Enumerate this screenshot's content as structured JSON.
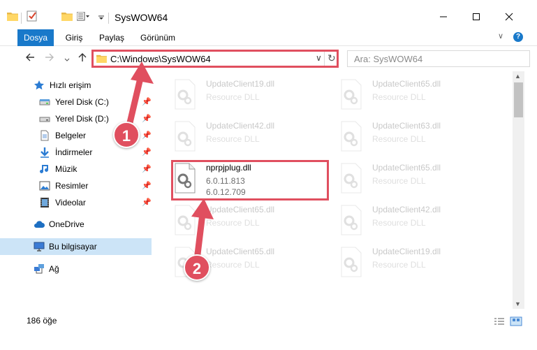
{
  "window": {
    "title": "SysWOW64"
  },
  "ribbon": {
    "tabs": [
      "Dosya",
      "Giriş",
      "Paylaş",
      "Görünüm"
    ],
    "help": "?"
  },
  "address": {
    "path": "C:\\Windows\\SysWOW64",
    "search_placeholder": "Ara: SysWOW64"
  },
  "nav": {
    "quick_access": "Hızlı erişim",
    "items": [
      {
        "label": "Yerel Disk (C:)",
        "icon": "drive-icon"
      },
      {
        "label": "Yerel Disk (D:)",
        "icon": "drive-icon"
      },
      {
        "label": "Belgeler",
        "icon": "documents-icon"
      },
      {
        "label": "İndirmeler",
        "icon": "downloads-icon"
      },
      {
        "label": "Müzik",
        "icon": "music-icon"
      },
      {
        "label": "Resimler",
        "icon": "pictures-icon"
      },
      {
        "label": "Videolar",
        "icon": "videos-icon"
      }
    ],
    "onedrive": "OneDrive",
    "this_pc": "Bu bilgisayar",
    "network": "Ağ"
  },
  "files": {
    "left": [
      {
        "name": "UpdateClient19.dll",
        "desc": "Resource DLL"
      },
      {
        "name": "UpdateClient42.dll",
        "desc": "Resource DLL"
      },
      {
        "name": "nprpjplug.dll",
        "desc": "6.0.11.813",
        "desc2": "6.0.12.709"
      },
      {
        "name": "UpdateClient65.dll",
        "desc": "Resource DLL"
      },
      {
        "name": "UpdateClient65.dll",
        "desc": "Resource DLL"
      }
    ],
    "right": [
      {
        "name": "UpdateClient65.dll",
        "desc": "Resource DLL"
      },
      {
        "name": "UpdateClient63.dll",
        "desc": "Resource DLL"
      },
      {
        "name": "UpdateClient65.dll",
        "desc": "Resource DLL"
      },
      {
        "name": "UpdateClient42.dll",
        "desc": "Resource DLL"
      },
      {
        "name": "UpdateClient19.dll",
        "desc": "Resource DLL"
      }
    ]
  },
  "status": {
    "count": "186 öğe"
  },
  "annotations": {
    "step1": "1",
    "step2": "2",
    "color": "#e04f5f"
  },
  "colors": {
    "accent": "#1979ca",
    "selected": "#cce4f7"
  }
}
